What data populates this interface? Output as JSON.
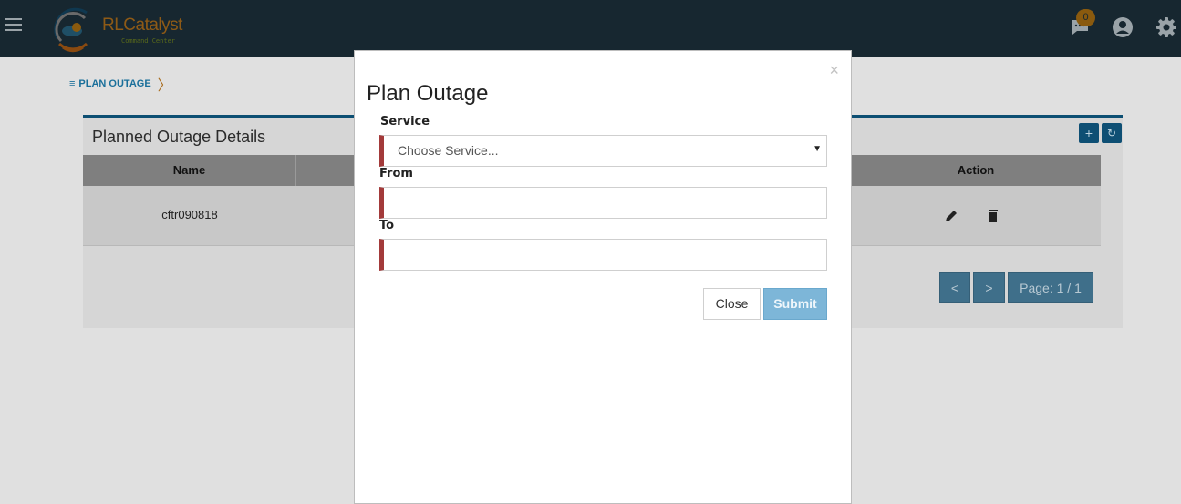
{
  "brand": {
    "name": "RLCatalyst",
    "tagline": "Command Center"
  },
  "header": {
    "notification_count": "0",
    "icons": [
      "menu-icon",
      "chat-icon",
      "user-icon",
      "gear-icon"
    ]
  },
  "breadcrumb": {
    "label": "PLAN OUTAGE"
  },
  "panel": {
    "title": "Planned Outage Details",
    "columns": [
      "Name",
      "Action"
    ],
    "rows": [
      {
        "name": "cftr090818"
      }
    ],
    "pager": {
      "prev": "<",
      "next": ">",
      "page_label": "Page: 1 / 1"
    }
  },
  "modal": {
    "title": "Plan Outage",
    "close_glyph": "×",
    "service_label": "Service",
    "service_placeholder": "Choose Service...",
    "from_label": "From",
    "from_value": "",
    "to_label": "To",
    "to_value": "",
    "close_button": "Close",
    "submit_button": "Submit"
  },
  "colors": {
    "topbar": "#2f3f48",
    "accent": "#1590c6",
    "required_marker": "#a33a3a",
    "submit": "#7db6d8"
  }
}
